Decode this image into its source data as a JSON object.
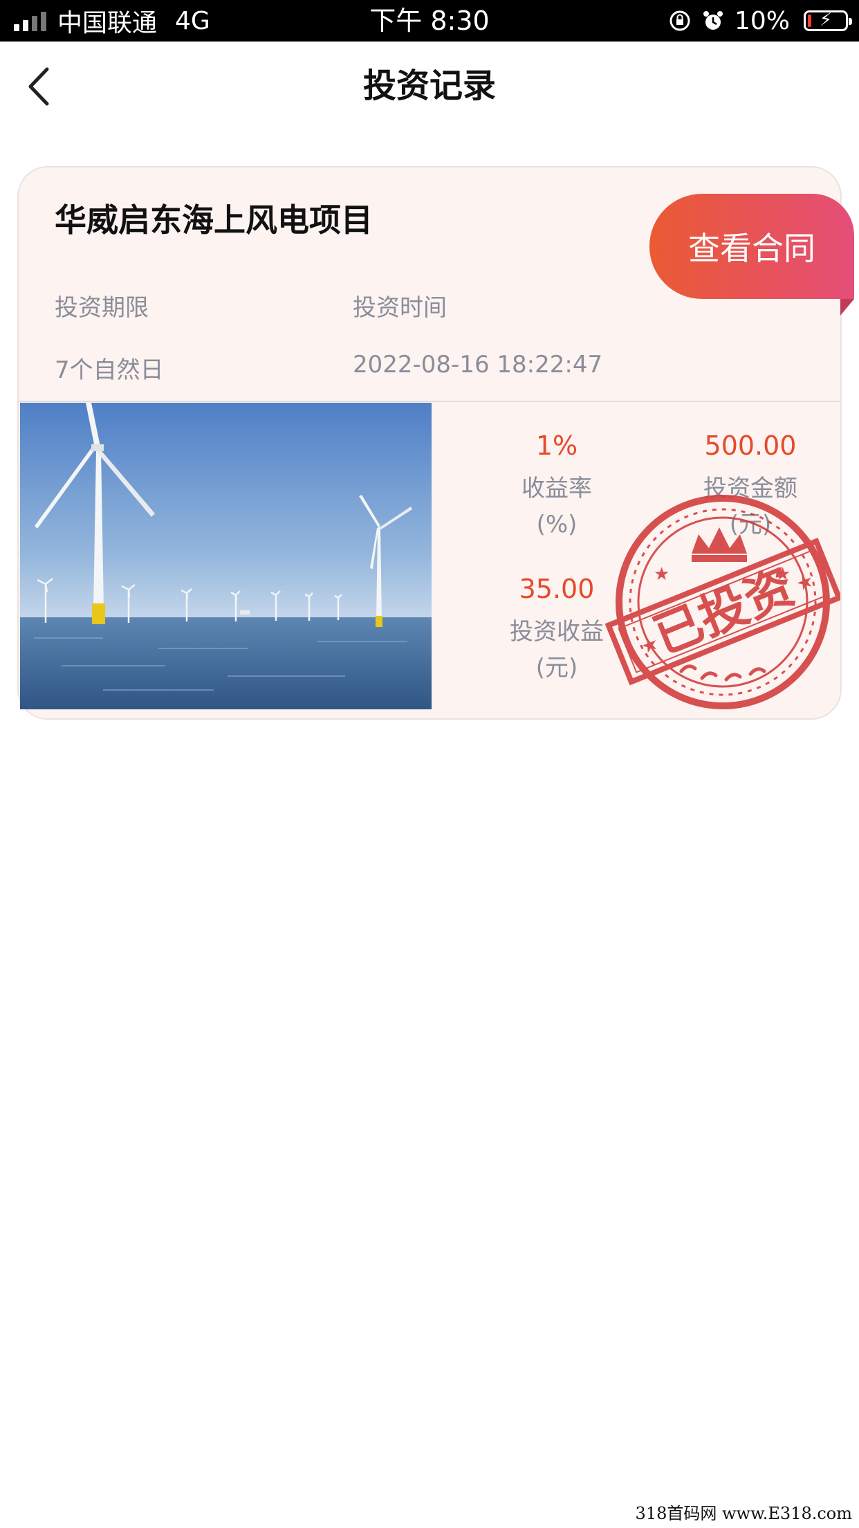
{
  "status_bar": {
    "carrier": "中国联通",
    "network": "4G",
    "time": "下午 8:30",
    "battery": "10%",
    "battery_level": 0.1,
    "icons": [
      "signal-icon",
      "rotation-lock-icon",
      "alarm-icon",
      "battery-icon"
    ]
  },
  "nav": {
    "back_icon": "chevron-left-icon",
    "title": "投资记录"
  },
  "record": {
    "project_name": "华威启东海上风电项目",
    "contract_button": "查看合同",
    "term_label": "投资期限",
    "term_value": "7个自然日",
    "time_label": "投资时间",
    "time_value": "2022-08-16 18:22:47",
    "image_subject": "offshore-wind-turbines-photo",
    "yield_value": "1%",
    "yield_label": "收益率",
    "yield_unit": "(%)",
    "amount_value": "500.00",
    "amount_label": "投资金额",
    "amount_unit": "(元)",
    "income_value": "35.00",
    "income_label": "投资收益",
    "income_unit": "(元)",
    "stamp_text": "已投资"
  },
  "colors": {
    "accent": "#e54a2c",
    "card_bg": "#fdf3f1",
    "button_gradient_start": "#ea5a33",
    "button_gradient_end": "#e54e78",
    "stamp_red": "#d23a3a",
    "label_gray": "#8a8d99"
  },
  "watermark": "318首码网 www.E318.com"
}
